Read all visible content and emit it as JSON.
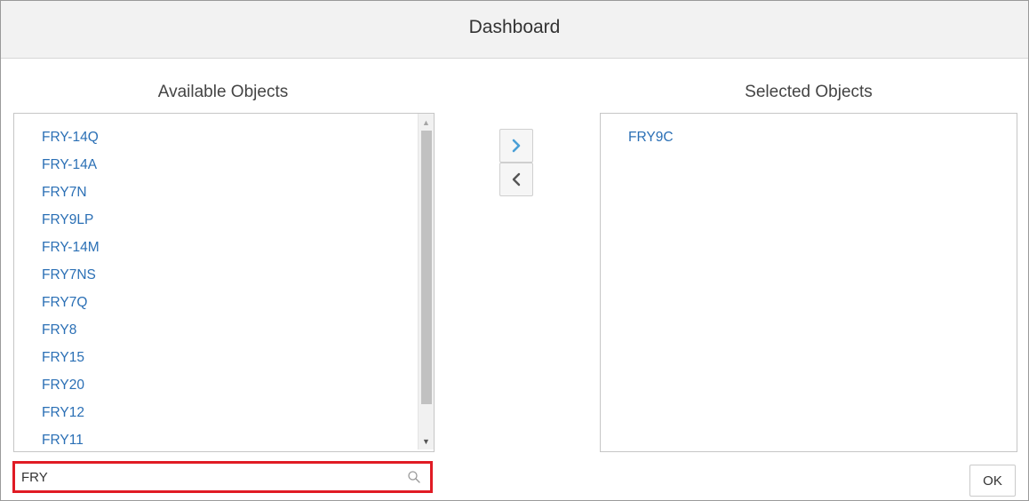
{
  "dialog": {
    "title": "Dashboard"
  },
  "available": {
    "heading": "Available Objects",
    "items": [
      "FRY-14Q",
      "FRY-14A",
      "FRY7N",
      "FRY9LP",
      "FRY-14M",
      "FRY7NS",
      "FRY7Q",
      "FRY8",
      "FRY15",
      "FRY20",
      "FRY12",
      "FRY11"
    ]
  },
  "selected": {
    "heading": "Selected Objects",
    "items": [
      "FRY9C"
    ]
  },
  "search": {
    "value": "FRY"
  },
  "buttons": {
    "ok_label": "OK"
  },
  "icons": {
    "move_right": "chevron-right-icon",
    "move_left": "chevron-left-icon",
    "search": "search-icon",
    "scroll_up": "scroll-up-arrow-icon",
    "scroll_down": "scroll-down-arrow-icon"
  },
  "colors": {
    "link": "#2a6fb5",
    "highlight_border": "#e01b24",
    "move_right_chevron": "#4a9fd6"
  }
}
